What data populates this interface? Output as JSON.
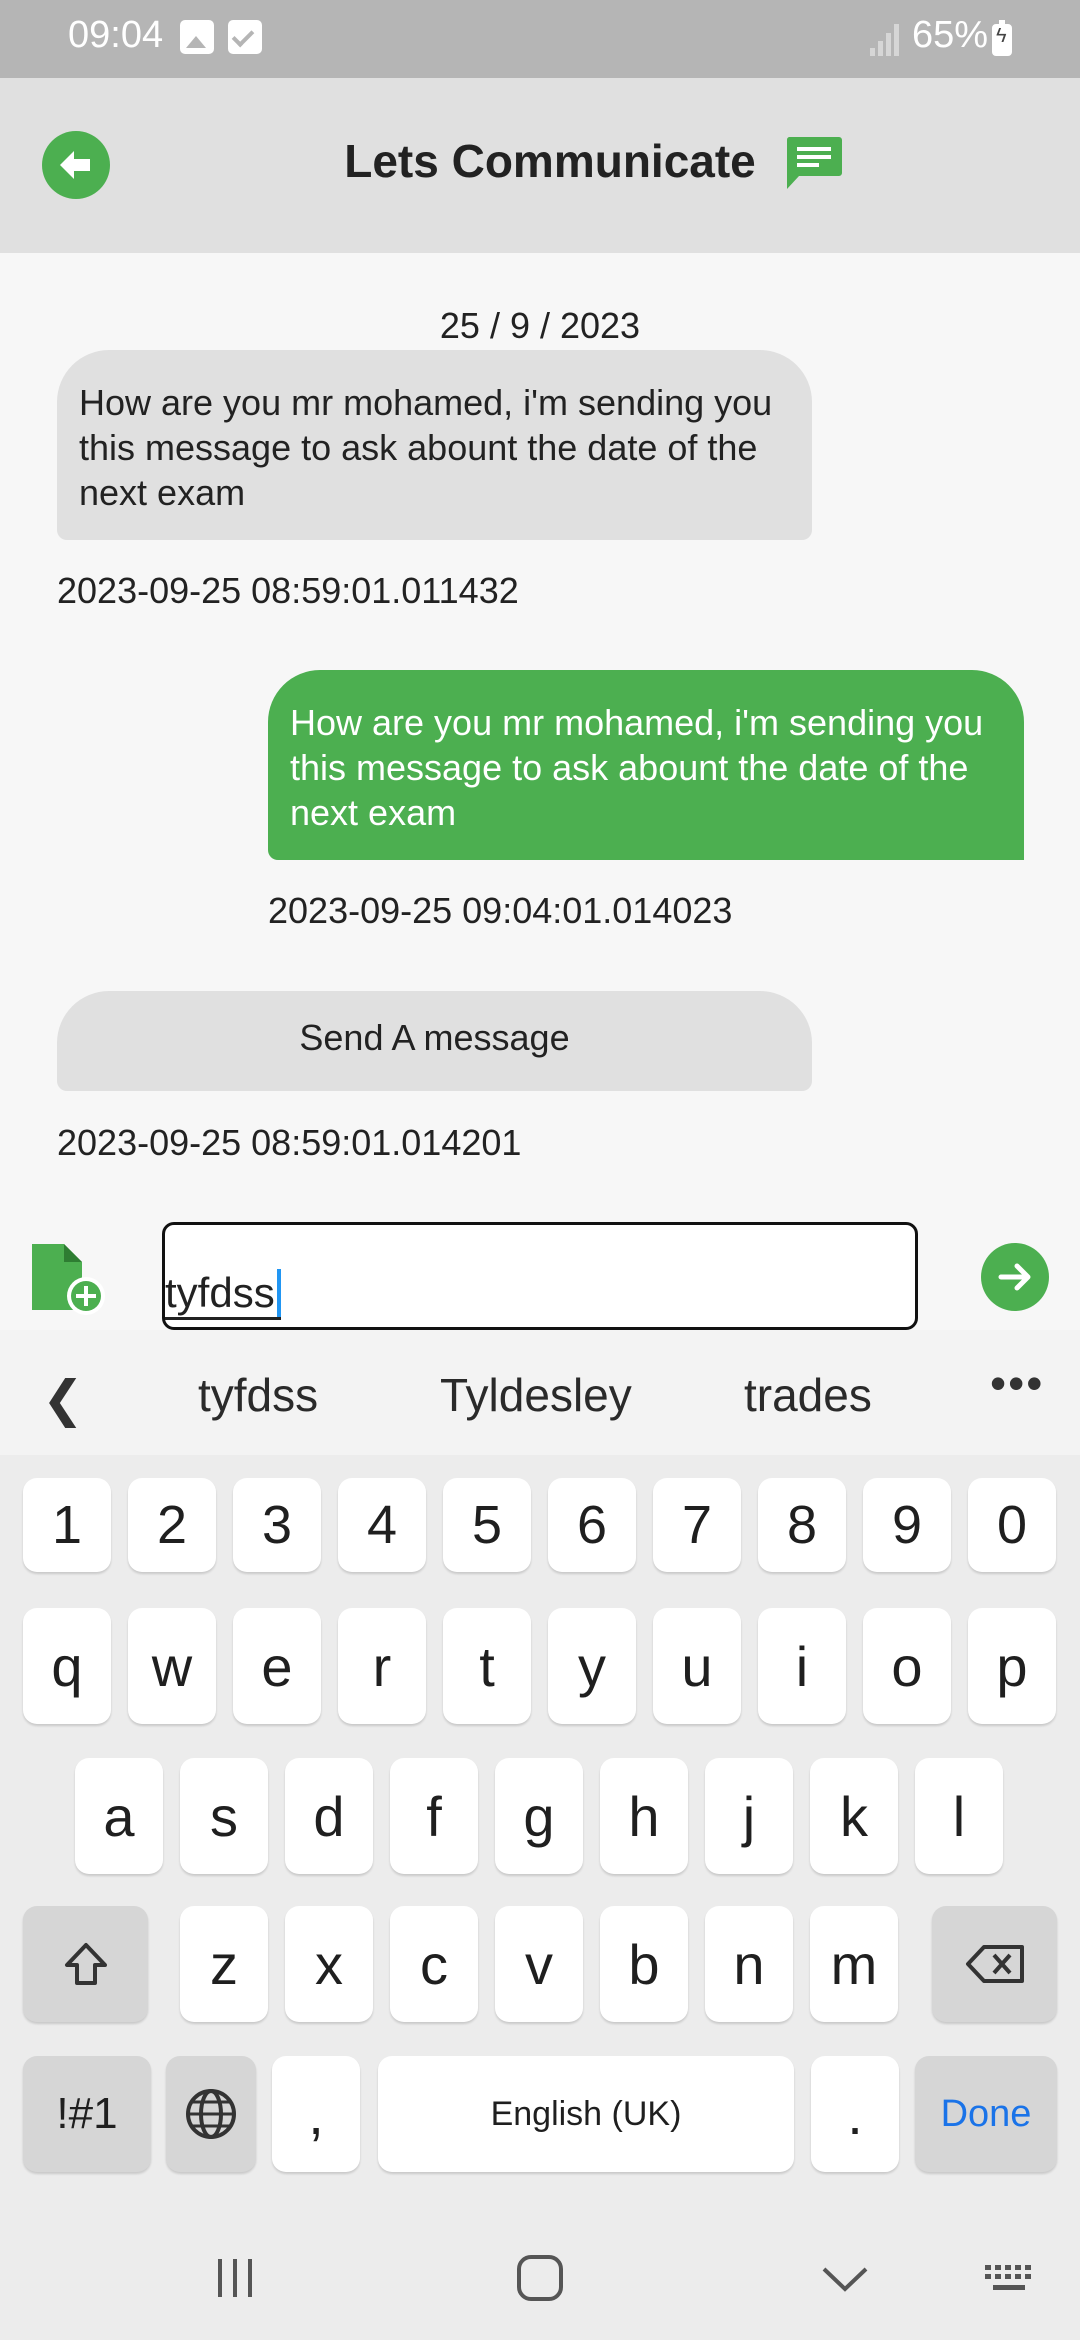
{
  "status_bar": {
    "time": "09:04",
    "battery": "65%"
  },
  "header": {
    "title": "Lets Communicate"
  },
  "chat": {
    "date": "25 / 9 / 2023",
    "messages": [
      {
        "direction": "received",
        "text": "How are you mr mohamed, i'm sending you this message to ask abount the date of  the next exam",
        "timestamp": "2023-09-25 08:59:01.011432"
      },
      {
        "direction": "sent",
        "text": "How are you mr mohamed, i'm sending you this message to ask abount the date of  the next exam",
        "timestamp": "2023-09-25 09:04:01.014023"
      },
      {
        "direction": "received",
        "text": "Send A message",
        "timestamp": "2023-09-25 08:59:01.014201"
      }
    ]
  },
  "composer": {
    "value": "tyfdss"
  },
  "keyboard": {
    "suggestions": [
      "tyfdss",
      "Tyldesley",
      "trades"
    ],
    "more": "•••",
    "row_numbers": [
      "1",
      "2",
      "3",
      "4",
      "5",
      "6",
      "7",
      "8",
      "9",
      "0"
    ],
    "row1": [
      "q",
      "w",
      "e",
      "r",
      "t",
      "y",
      "u",
      "i",
      "o",
      "p"
    ],
    "row2": [
      "a",
      "s",
      "d",
      "f",
      "g",
      "h",
      "j",
      "k",
      "l"
    ],
    "row3": [
      "z",
      "x",
      "c",
      "v",
      "b",
      "n",
      "m"
    ],
    "symbols_label": "!#1",
    "comma": ",",
    "space_label": "English (UK)",
    "period": ".",
    "done_label": "Done"
  },
  "colors": {
    "accent": "#4caf50",
    "app_bar": "#e0e0e0",
    "bubble_received": "#e0e0e0",
    "done_blue": "#1a73e8"
  },
  "icons": [
    "back-arrow-icon",
    "chat-icon",
    "add-file-icon",
    "send-arrow-icon",
    "shift-icon",
    "backspace-icon",
    "globe-icon"
  ]
}
